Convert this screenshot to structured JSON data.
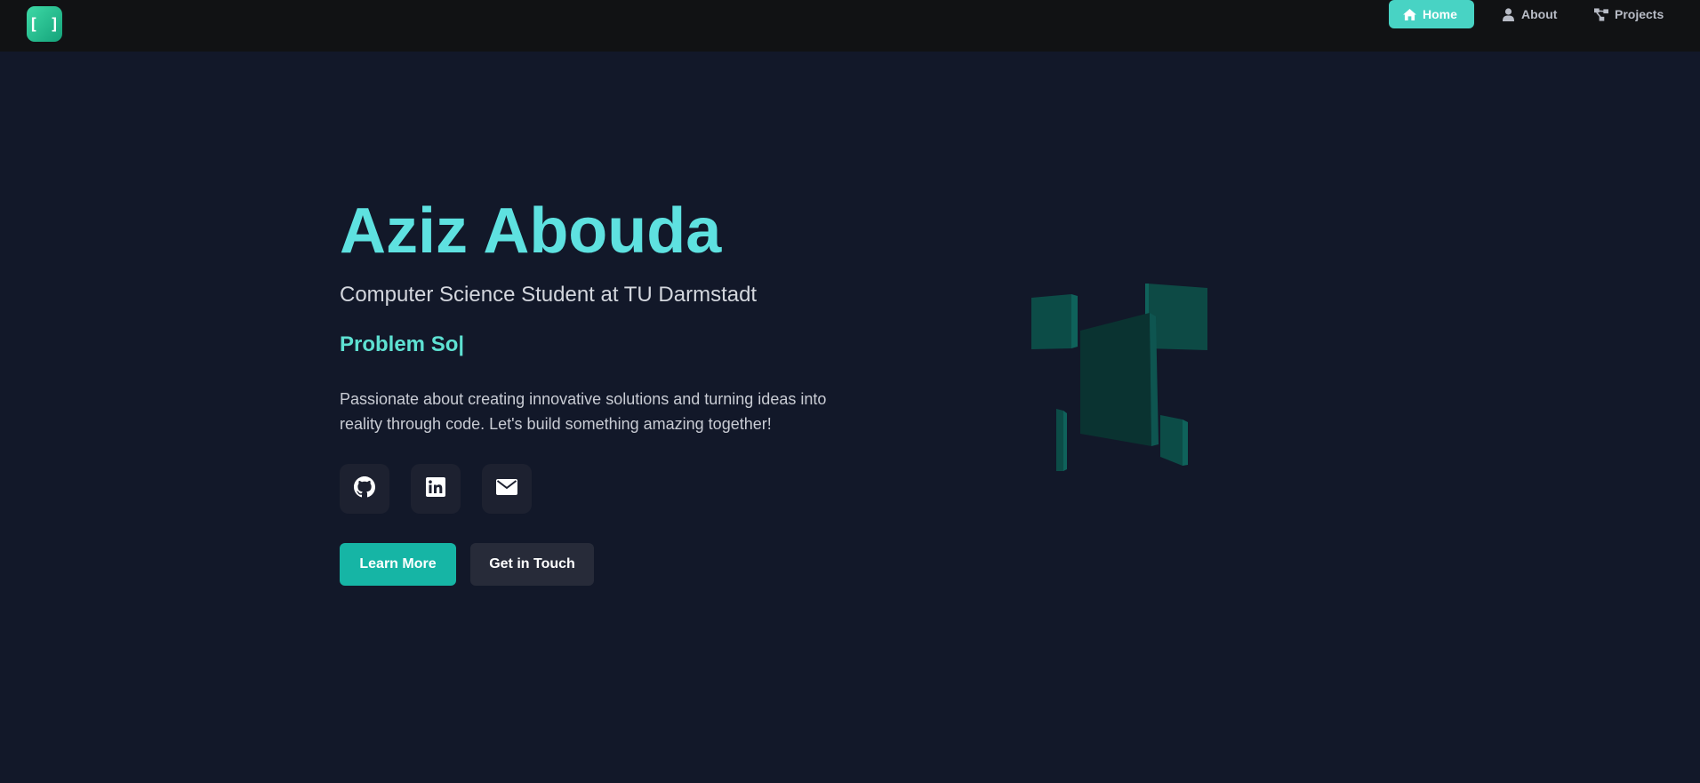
{
  "header": {
    "logo_text": "[ ]",
    "nav": [
      {
        "label": "Home",
        "icon": "home-icon",
        "active": true
      },
      {
        "label": "About",
        "icon": "user-icon",
        "active": false
      },
      {
        "label": "Projects",
        "icon": "project-diagram-icon",
        "active": false
      }
    ]
  },
  "hero": {
    "name": "Aziz Abouda",
    "subtitle": "Computer Science Student at TU Darmstadt",
    "typing_text": "Problem So|",
    "description": "Passionate about creating innovative solutions and turning ideas into reality through code. Let's build something amazing together!",
    "social": [
      {
        "icon": "github-icon"
      },
      {
        "icon": "linkedin-icon"
      },
      {
        "icon": "email-icon"
      }
    ],
    "buttons": {
      "primary": "Learn More",
      "secondary": "Get in Touch"
    }
  },
  "colors": {
    "accent": "#5ee1e0",
    "primary_button": "#16b5a5",
    "active_nav": "#48d3c4",
    "background": "#121829",
    "navbar": "#111214",
    "cube": "#0c4c47"
  }
}
